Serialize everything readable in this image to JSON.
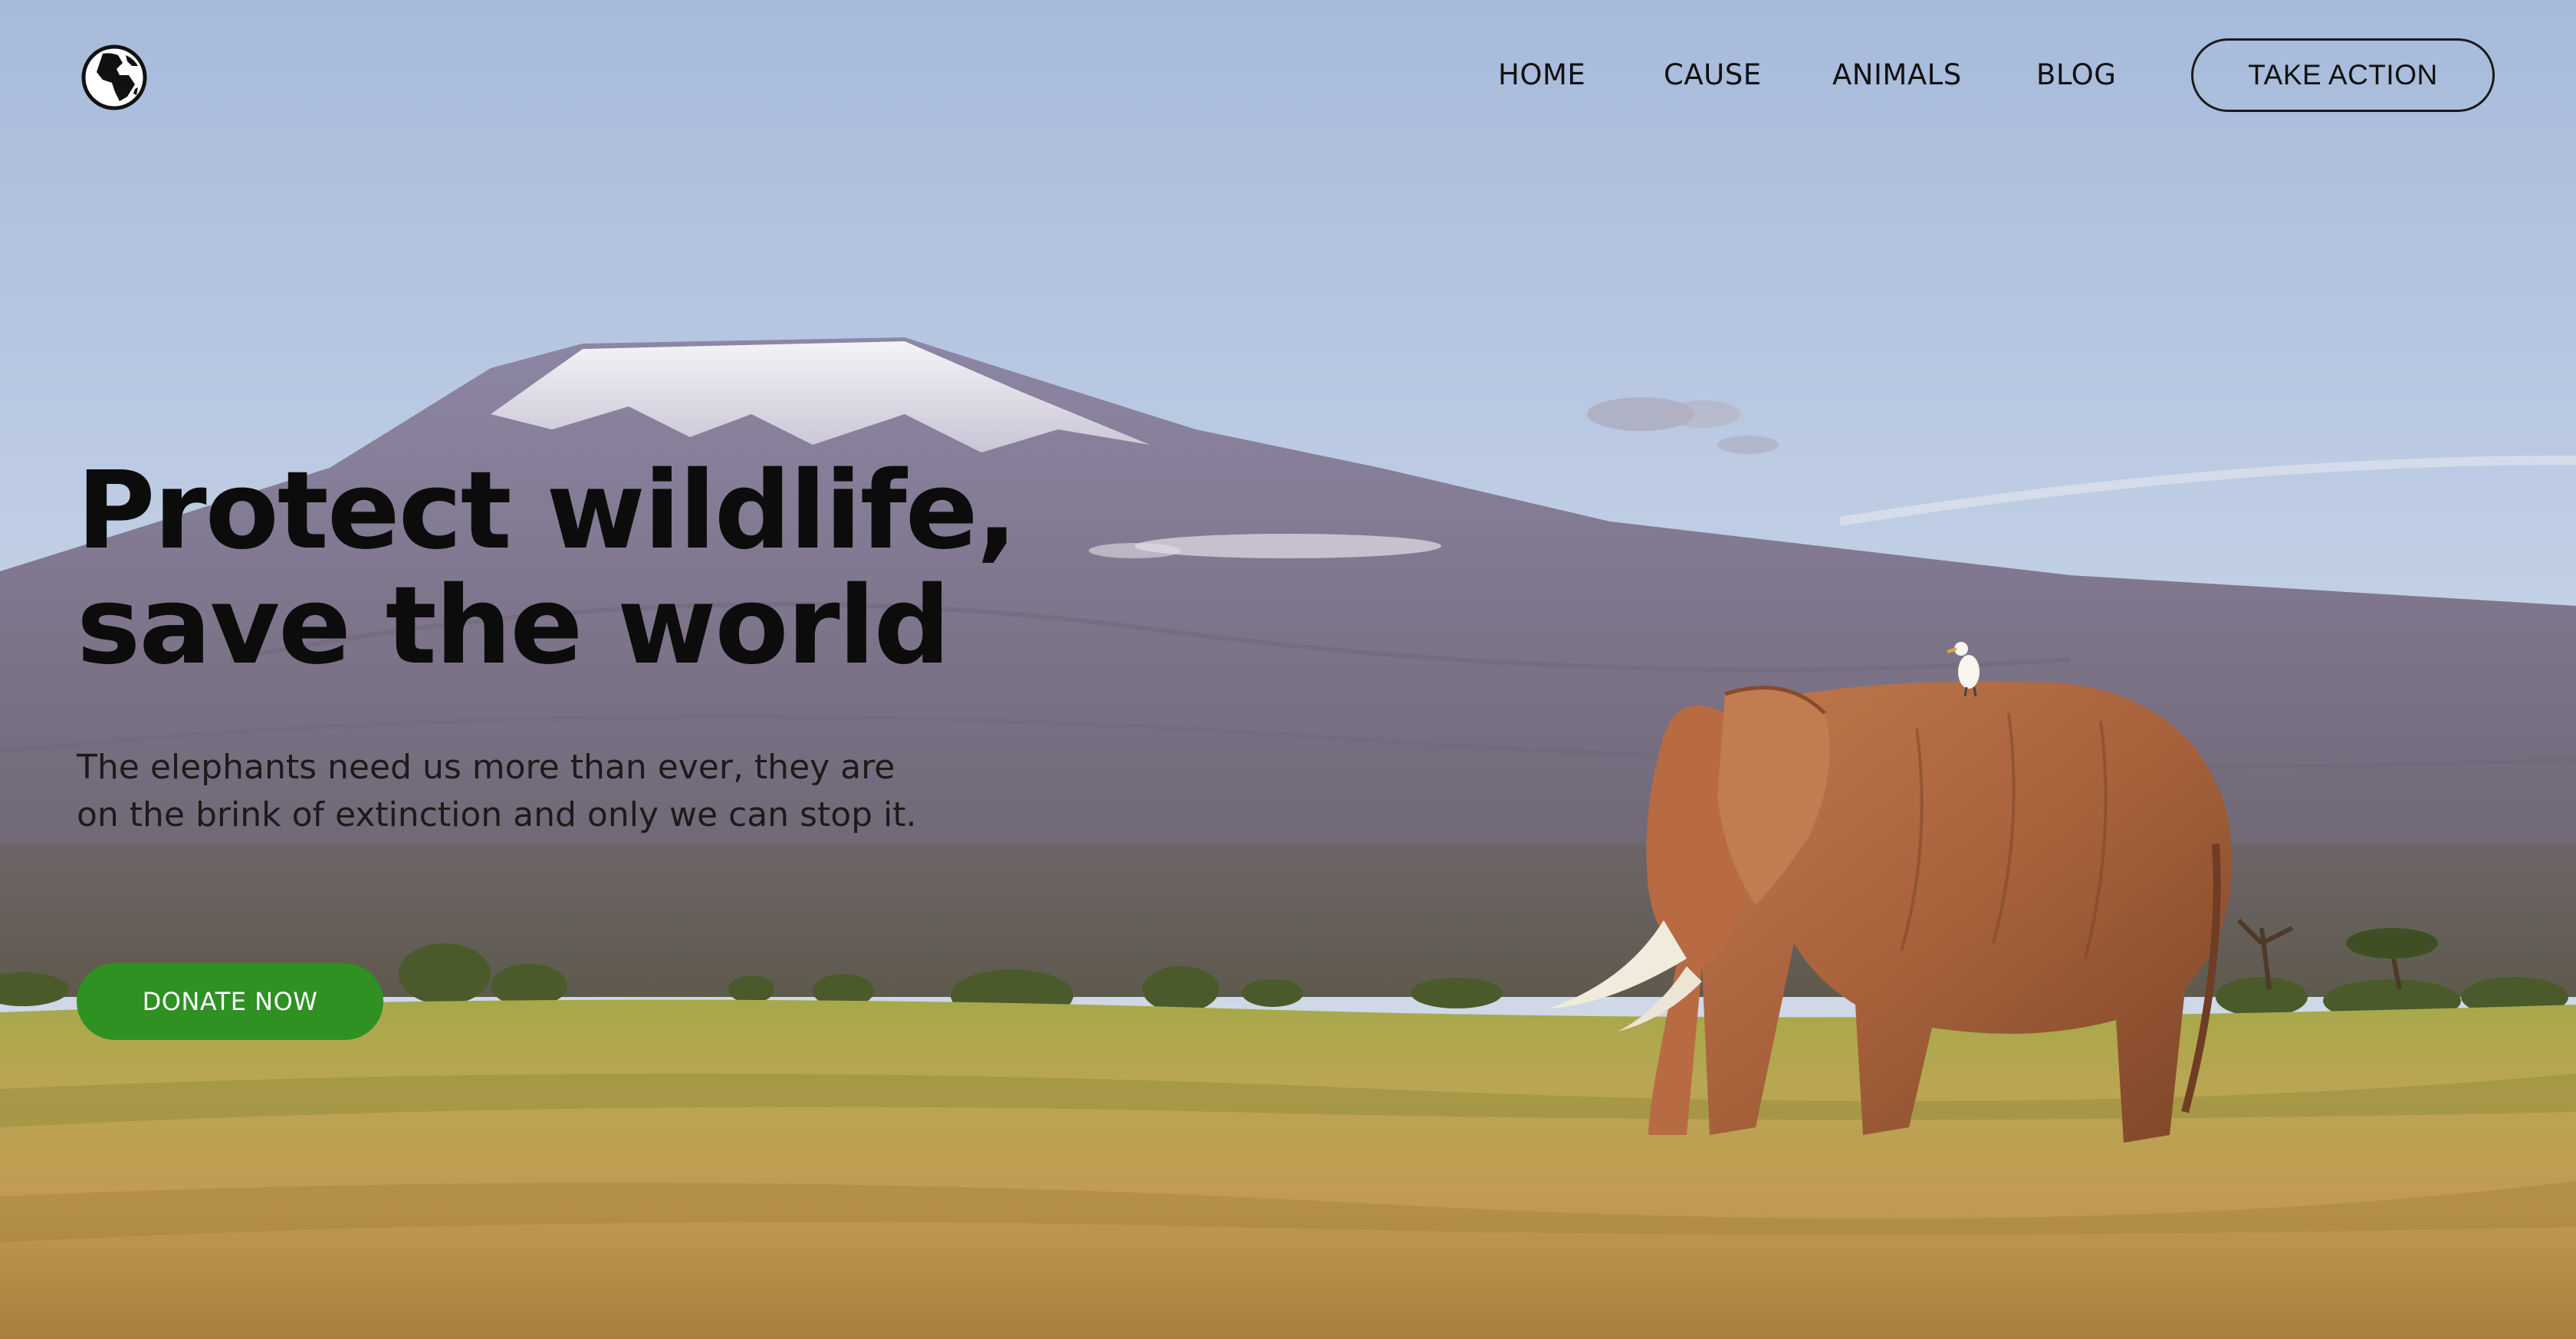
{
  "brand": {
    "logo_icon": "globe-icon"
  },
  "nav": {
    "items": [
      {
        "label": "HOME"
      },
      {
        "label": "CAUSE"
      },
      {
        "label": "ANIMALS"
      },
      {
        "label": "BLOG"
      }
    ],
    "cta_label": "TAKE ACTION"
  },
  "hero": {
    "headline_line1": "Protect wildlife,",
    "headline_line2": "save the world",
    "subtext_line1": "The elephants need us more than ever, they are",
    "subtext_line2": "on the brink of extinction and only we can stop it.",
    "donate_label": "DONATE NOW",
    "background_description_icon": "elephant-savanna-photo"
  },
  "colors": {
    "accent_green": "#2e9122",
    "text_dark": "#111111",
    "sky_top": "#a9bddb",
    "grass": "#b89a45"
  }
}
